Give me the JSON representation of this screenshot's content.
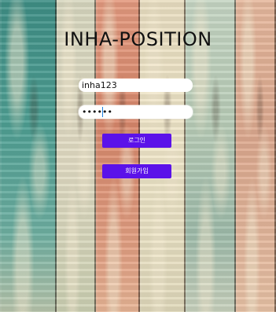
{
  "app": {
    "title": "INHA-POSITION"
  },
  "login_form": {
    "username_value": "inha123",
    "password_value": "••••••",
    "login_label": "로그인",
    "signup_label": "회원가입"
  },
  "colors": {
    "button_bg": "#5b12e9",
    "button_text": "#ffffff",
    "input_bg": "#ffffff"
  }
}
